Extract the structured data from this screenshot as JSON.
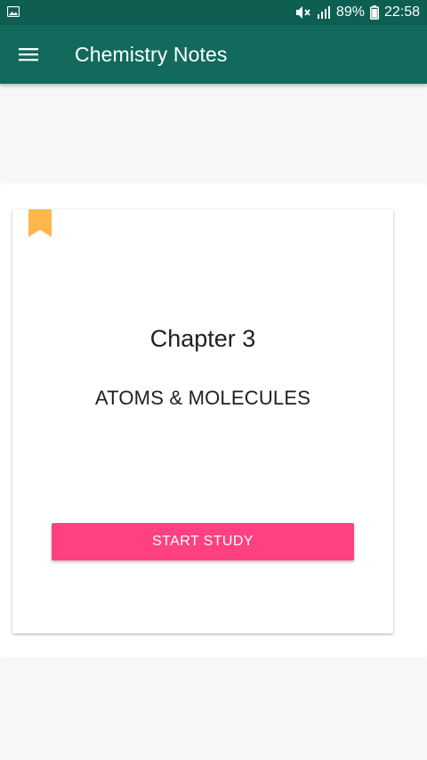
{
  "status_bar": {
    "battery": "89%",
    "time": "22:58",
    "icons": [
      "image-icon",
      "mute-icon",
      "signal-icon",
      "battery-icon"
    ]
  },
  "app_bar": {
    "title": "Chemistry Notes",
    "menu_icon": "menu-icon",
    "colors": {
      "status_bar": "#0f5e52",
      "app_bar": "#116a5c"
    }
  },
  "chapter_card": {
    "bookmark_icon": "bookmark-icon",
    "bookmark_color": "#ffb74d",
    "chapter_number": "Chapter 3",
    "chapter_title": "ATOMS & MOLECULES",
    "button_label": "START STUDY",
    "button_color": "#ff4081"
  }
}
